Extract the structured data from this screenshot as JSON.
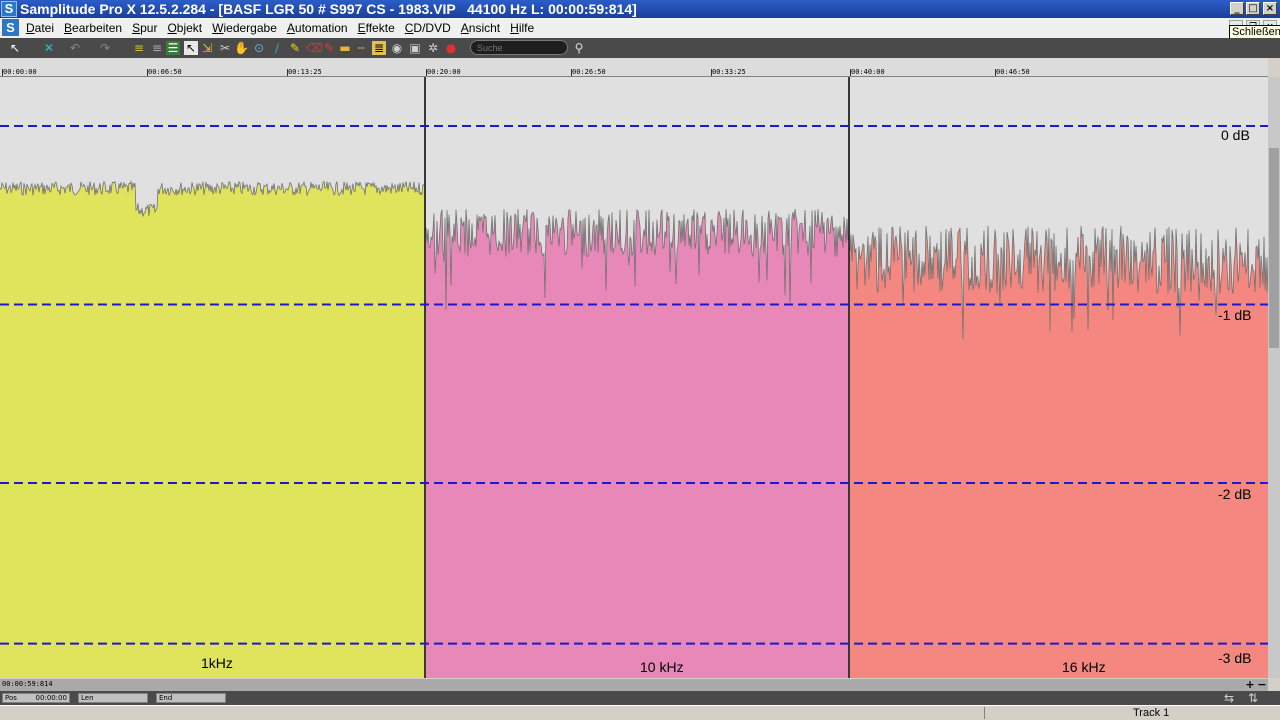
{
  "window": {
    "title": "Samplitude Pro X 12.5.2.284 - [BASF LGR 50 # S997 CS - 1983.VIP   44100 Hz L: 00:00:59:814]",
    "close_tooltip": "Schließen"
  },
  "menu": {
    "items": [
      "Datei",
      "Bearbeiten",
      "Spur",
      "Objekt",
      "Wiedergabe",
      "Automation",
      "Effekte",
      "CD/DVD",
      "Ansicht",
      "Hilfe"
    ]
  },
  "toolbar": {
    "search_placeholder": "Suche"
  },
  "ruler": {
    "ticks": [
      {
        "label": "00:00:00",
        "t": 0
      },
      {
        "label": "00:06:50",
        "t": 410
      },
      {
        "label": "00:13:25",
        "t": 805
      },
      {
        "label": "00:20:00",
        "t": 1200
      },
      {
        "label": "00:26:50",
        "t": 1610
      },
      {
        "label": "00:33:25",
        "t": 2005
      },
      {
        "label": "00:40:00",
        "t": 2400
      },
      {
        "label": "00:46:50",
        "t": 2810
      }
    ]
  },
  "track": {
    "name": "Track 1",
    "db_scale": [
      "0 dB",
      "-1 dB",
      "-2 dB",
      "-3 dB"
    ],
    "objects": [
      {
        "label": "1kHz",
        "color": "#e0e45c",
        "start": 0,
        "end": 1200,
        "level_db": -0.35
      },
      {
        "label": "10 kHz",
        "color": "#e888b8",
        "start": 1200,
        "end": 2400,
        "level_db": -0.6
      },
      {
        "label": "16 kHz",
        "color": "#f48880",
        "start": 2400,
        "end": 3600,
        "level_db": -0.75
      }
    ]
  },
  "scroll": {
    "position": "00:00:59:814"
  },
  "transport": {
    "pos_label": "Pos",
    "pos_value": "00:00:00",
    "len_label": "Len",
    "end_label": "End"
  },
  "colors": {
    "grid_line": "#1a1ad0",
    "background": "#e0e0e0",
    "title_bar": "#2c5ec8"
  }
}
